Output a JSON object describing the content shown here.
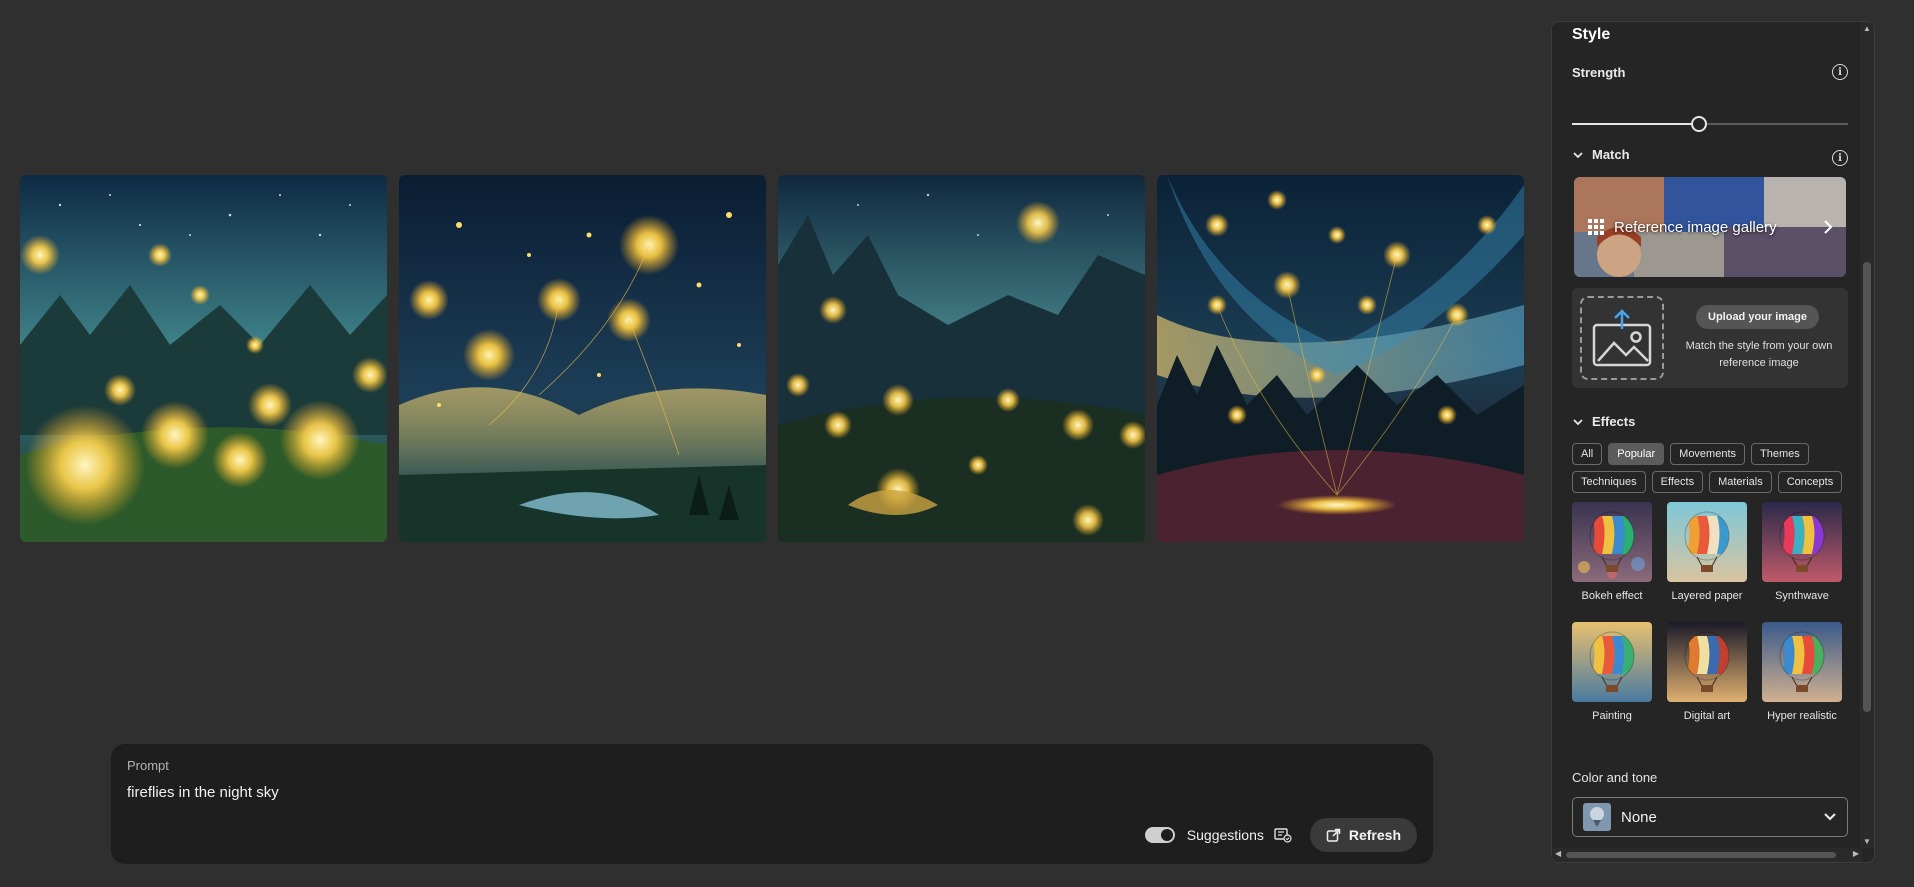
{
  "images": [
    {
      "alt": "generated-image-1"
    },
    {
      "alt": "generated-image-2"
    },
    {
      "alt": "generated-image-3"
    },
    {
      "alt": "generated-image-4"
    }
  ],
  "prompt": {
    "label": "Prompt",
    "text": "fireflies in the night sky",
    "suggestions_label": "Suggestions",
    "suggestions_on": true,
    "refresh_label": "Refresh"
  },
  "panel": {
    "title": "Style",
    "strength_label": "Strength",
    "strength_value": 0.46,
    "match_label": "Match",
    "reference_gallery_label": "Reference image gallery",
    "upload_button": "Upload your image",
    "upload_desc": "Match the style from your own reference image",
    "effects_label": "Effects",
    "effect_tabs_row1": [
      "All",
      "Popular",
      "Movements",
      "Themes"
    ],
    "effect_tabs_row2": [
      "Techniques",
      "Effects",
      "Materials",
      "Concepts"
    ],
    "active_tab": "Popular",
    "effects": [
      "Bokeh effect",
      "Layered paper",
      "Synthwave",
      "Painting",
      "Digital art",
      "Hyper realistic"
    ],
    "color_tone_label": "Color and tone",
    "color_tone_value": "None"
  },
  "colors": {
    "background": "#2f2f2f",
    "panel": "#252525",
    "prompt_bar": "#1e1e1e",
    "firefly": "#ffd34d"
  }
}
